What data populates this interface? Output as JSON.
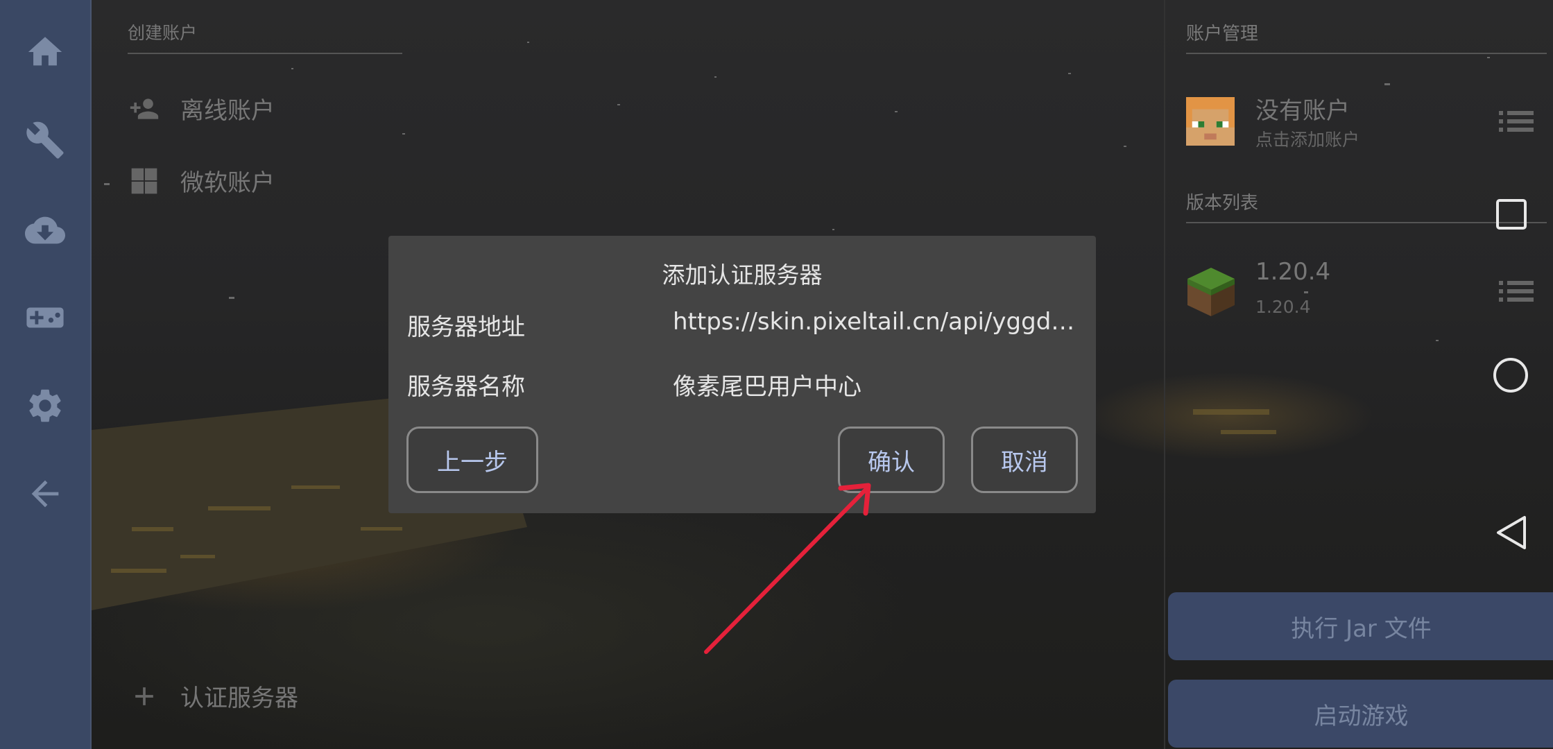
{
  "left_rail": {
    "items": [
      {
        "icon": "home-icon"
      },
      {
        "icon": "wrench-icon"
      },
      {
        "icon": "cloud-download-icon"
      },
      {
        "icon": "gamepad-icon"
      },
      {
        "icon": "gear-icon"
      },
      {
        "icon": "back-arrow-icon"
      }
    ]
  },
  "create_account": {
    "title": "创建账户",
    "options": [
      {
        "label": "离线账户",
        "icon": "add-person-icon"
      },
      {
        "label": "微软账户",
        "icon": "windows-icon"
      }
    ],
    "auth_server_label": "认证服务器"
  },
  "account_management": {
    "title": "账户管理",
    "account_name": "没有账户",
    "account_hint": "点击添加账户"
  },
  "version_list": {
    "title": "版本列表",
    "version_name": "1.20.4",
    "version_sub": "1.20.4"
  },
  "buttons": {
    "run_jar": "执行 Jar 文件",
    "launch_game": "启动游戏"
  },
  "dialog": {
    "title": "添加认证服务器",
    "server_address_label": "服务器地址",
    "server_address_value": "https://skin.pixeltail.cn/api/yggdrasil",
    "server_name_label": "服务器名称",
    "server_name_value": "像素尾巴用户中心",
    "back_button": "上一步",
    "confirm_button": "确认",
    "cancel_button": "取消"
  },
  "colors": {
    "rail": "#3a4864",
    "button_primary": "#3b4867",
    "dialog_bg": "#444444",
    "annotation_arrow": "#e5213a"
  }
}
